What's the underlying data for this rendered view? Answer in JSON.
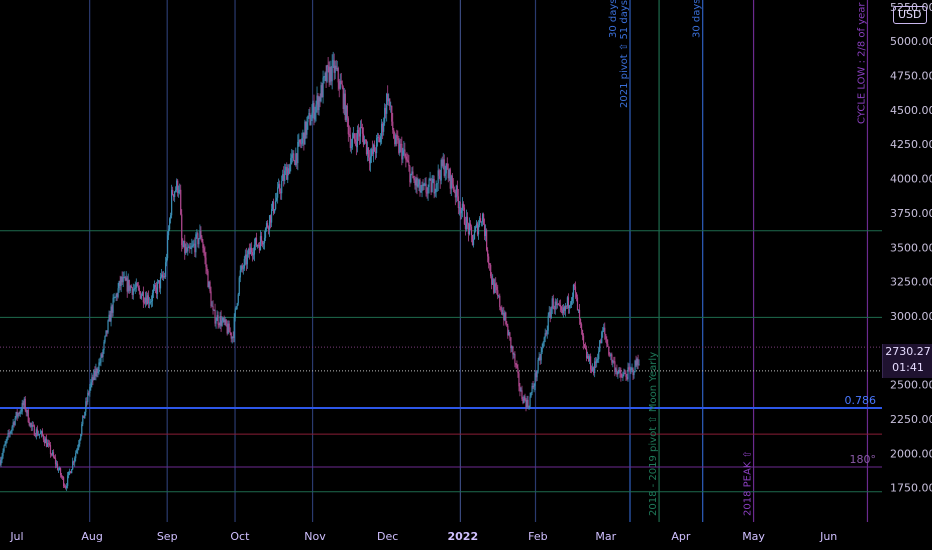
{
  "currency_label": "USD",
  "current_price": {
    "value": "2730.27",
    "countdown": "01:41"
  },
  "chart_data": {
    "type": "candlestick",
    "y_axis": {
      "ticks": [
        1750,
        2000,
        2250,
        2500,
        2750,
        3000,
        3250,
        3500,
        3750,
        4000,
        4250,
        4500,
        4750,
        5000,
        5250
      ],
      "tick_labels": [
        "1750.00",
        "2000.00",
        "2250.00",
        "2500.00",
        "2750.00",
        "3000.00",
        "3250.00",
        "3500.00",
        "3750.00",
        "4000.00",
        "4250.00",
        "4500.00",
        "4750.00",
        "5000.00",
        "5250.00"
      ],
      "range": [
        1500,
        5300
      ]
    },
    "x_axis": {
      "labels": [
        "Jul",
        "Aug",
        "Sep",
        "Oct",
        "Nov",
        "Dec",
        "2022",
        "Feb",
        "Mar",
        "Apr",
        "May",
        "Jun"
      ],
      "dates": [
        "2021-07-01",
        "2021-08-01",
        "2021-09-01",
        "2021-10-01",
        "2021-11-01",
        "2021-12-01",
        "2022-01-01",
        "2022-02-01",
        "2022-03-01",
        "2022-04-01",
        "2022-05-01",
        "2022-06-01"
      ],
      "range": [
        "2021-06-24",
        "2022-06-23"
      ]
    },
    "price_path": [
      [
        "2021-06-24",
        1950
      ],
      [
        "2021-06-30",
        2250
      ],
      [
        "2021-07-04",
        2360
      ],
      [
        "2021-07-07",
        2180
      ],
      [
        "2021-07-12",
        2120
      ],
      [
        "2021-07-17",
        1930
      ],
      [
        "2021-07-21",
        1760
      ],
      [
        "2021-07-26",
        2050
      ],
      [
        "2021-07-31",
        2480
      ],
      [
        "2021-08-05",
        2700
      ],
      [
        "2021-08-09",
        3050
      ],
      [
        "2021-08-13",
        3250
      ],
      [
        "2021-08-20",
        3180
      ],
      [
        "2021-08-25",
        3120
      ],
      [
        "2021-08-31",
        3300
      ],
      [
        "2021-09-03",
        3900
      ],
      [
        "2021-09-06",
        3960
      ],
      [
        "2021-09-07",
        3500
      ],
      [
        "2021-09-10",
        3450
      ],
      [
        "2021-09-15",
        3600
      ],
      [
        "2021-09-20",
        3000
      ],
      [
        "2021-09-23",
        2970
      ],
      [
        "2021-09-28",
        2850
      ],
      [
        "2021-10-01",
        3300
      ],
      [
        "2021-10-06",
        3500
      ],
      [
        "2021-10-10",
        3550
      ],
      [
        "2021-10-15",
        3800
      ],
      [
        "2021-10-20",
        4050
      ],
      [
        "2021-10-25",
        4200
      ],
      [
        "2021-10-29",
        4400
      ],
      [
        "2021-11-03",
        4600
      ],
      [
        "2021-11-06",
        4750
      ],
      [
        "2021-11-09",
        4800
      ],
      [
        "2021-11-12",
        4650
      ],
      [
        "2021-11-16",
        4250
      ],
      [
        "2021-11-20",
        4350
      ],
      [
        "2021-11-24",
        4150
      ],
      [
        "2021-11-28",
        4300
      ],
      [
        "2021-12-01",
        4620
      ],
      [
        "2021-12-04",
        4250
      ],
      [
        "2021-12-07",
        4200
      ],
      [
        "2021-12-11",
        4000
      ],
      [
        "2021-12-15",
        3900
      ],
      [
        "2021-12-20",
        3950
      ],
      [
        "2021-12-24",
        4100
      ],
      [
        "2021-12-28",
        3950
      ],
      [
        "2022-01-01",
        3750
      ],
      [
        "2022-01-05",
        3550
      ],
      [
        "2022-01-09",
        3750
      ],
      [
        "2022-01-13",
        3250
      ],
      [
        "2022-01-18",
        3000
      ],
      [
        "2022-01-22",
        2700
      ],
      [
        "2022-01-25",
        2430
      ],
      [
        "2022-01-28",
        2350
      ],
      [
        "2022-02-02",
        2700
      ],
      [
        "2022-02-07",
        3100
      ],
      [
        "2022-02-11",
        3000
      ],
      [
        "2022-02-16",
        3200
      ],
      [
        "2022-02-20",
        2750
      ],
      [
        "2022-02-24",
        2600
      ],
      [
        "2022-02-28",
        2900
      ],
      [
        "2022-03-03",
        2700
      ],
      [
        "2022-03-07",
        2550
      ],
      [
        "2022-03-12",
        2600
      ],
      [
        "2022-03-15",
        2700
      ]
    ],
    "horizontal_levels": [
      {
        "price": 3620,
        "color": "#1e6b4e",
        "label": ""
      },
      {
        "price": 2990,
        "color": "#1e6b4e",
        "label": ""
      },
      {
        "price": 2773,
        "color": "#7a3d7a",
        "label": "",
        "dotted": true
      },
      {
        "price": 2600,
        "color": "#c0c0c0",
        "label": "",
        "dotted": true
      },
      {
        "price": 2330,
        "color": "#2d57e8",
        "label": "0.786"
      },
      {
        "price": 2140,
        "color": "#8a1e36",
        "label": ""
      },
      {
        "price": 1900,
        "color": "#6b2a8f",
        "label": "180°"
      },
      {
        "price": 1720,
        "color": "#1e6b4e",
        "label": ""
      }
    ],
    "vertical_markers": [
      {
        "date": "2021-07-31",
        "color": "#2a3a6e",
        "label": ""
      },
      {
        "date": "2021-09-01",
        "color": "#2a3a6e",
        "label": ""
      },
      {
        "date": "2021-09-29",
        "color": "#2a3a6e",
        "label": ""
      },
      {
        "date": "2021-10-31",
        "color": "#2a3a6e",
        "label": ""
      },
      {
        "date": "2021-12-31",
        "color": "#3a4a7e",
        "label": ""
      },
      {
        "date": "2022-01-31",
        "color": "#2a3a6e",
        "label": ""
      },
      {
        "date": "2022-03-11",
        "color": "#2f5fbf",
        "label": "2021 pivot ⇧ 51 days",
        "label2": "30 days"
      },
      {
        "date": "2022-03-23",
        "color": "#1e6b4e",
        "label": "2018 - 2019 pivot ⇧ Moon Yearly"
      },
      {
        "date": "2022-04-10",
        "color": "#2f5fbf",
        "label": "30 days"
      },
      {
        "date": "2022-05-01",
        "color": "#6b2a8f",
        "label": "2018 PEAK ⇧"
      },
      {
        "date": "2022-06-17",
        "color": "#6b2a8f",
        "label": "CYCLE LOW : 2/8 of year"
      }
    ]
  }
}
